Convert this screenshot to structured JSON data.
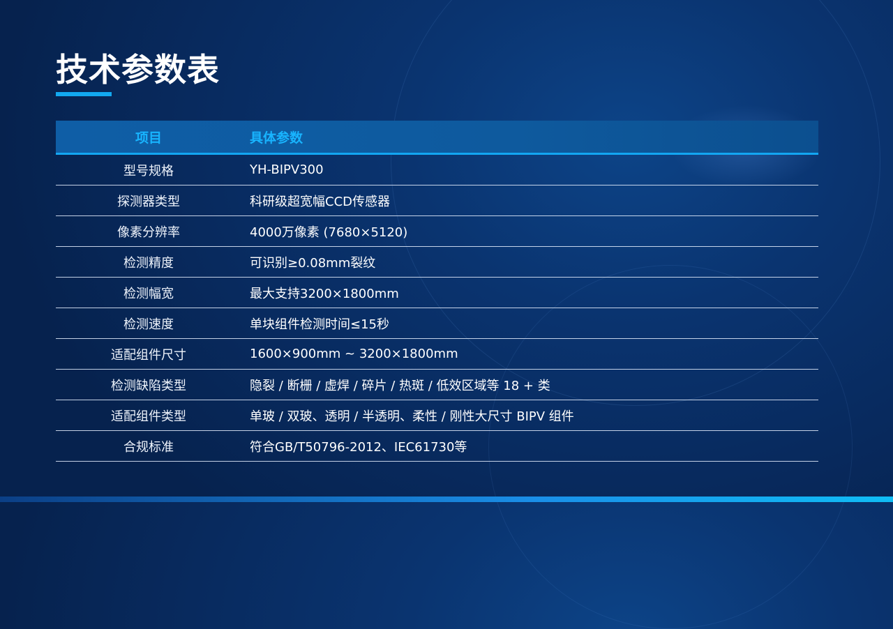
{
  "page": {
    "title": "技术参数表",
    "accent_color": "#12a9f0",
    "header_text_color": "#18b4ff"
  },
  "table": {
    "headers": [
      "项目",
      "具体参数"
    ],
    "rows": [
      {
        "item": "型号规格",
        "value": "YH-BIPV300"
      },
      {
        "item": "探测器类型",
        "value": "科研级超宽幅CCD传感器"
      },
      {
        "item": "像素分辨率",
        "value": "4000万像素 (7680×5120)"
      },
      {
        "item": "检测精度",
        "value": "可识别≥0.08mm裂纹"
      },
      {
        "item": "检测幅宽",
        "value": "最大支持3200×1800mm"
      },
      {
        "item": "检测速度",
        "value": "单块组件检测时间≤15秒"
      },
      {
        "item": "适配组件尺寸",
        "value": "1600×900mm ~ 3200×1800mm"
      },
      {
        "item": "检测缺陷类型",
        "value": "隐裂 / 断栅 / 虚焊 / 碎片 / 热斑 / 低效区域等 18 + 类"
      },
      {
        "item": "适配组件类型",
        "value": "单玻 / 双玻、透明 / 半透明、柔性 / 刚性大尺寸 BIPV 组件"
      },
      {
        "item": "合规标准",
        "value": "符合GB/T50796-2012、IEC61730等"
      }
    ]
  }
}
